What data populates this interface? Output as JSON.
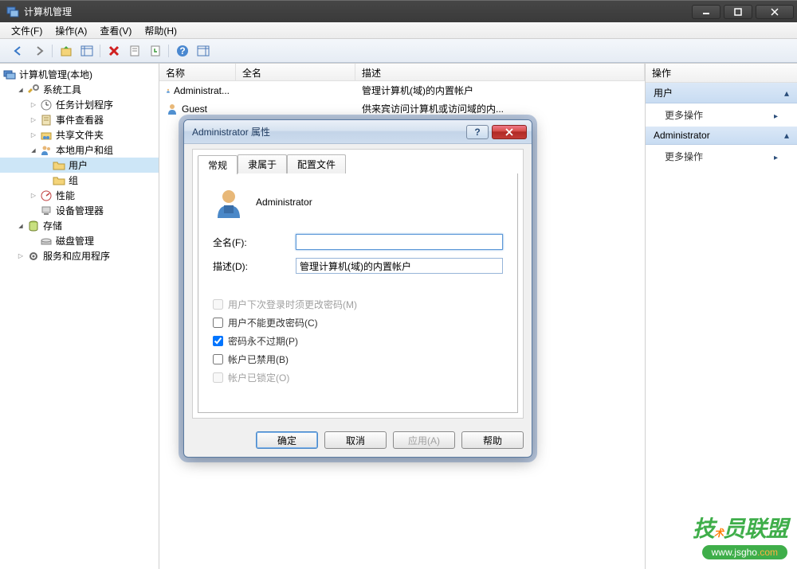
{
  "window": {
    "title": "计算机管理"
  },
  "menu": {
    "file": "文件(F)",
    "action": "操作(A)",
    "view": "查看(V)",
    "help": "帮助(H)"
  },
  "tree": {
    "root": "计算机管理(本地)",
    "system_tools": "系统工具",
    "task_scheduler": "任务计划程序",
    "event_viewer": "事件查看器",
    "shared_folders": "共享文件夹",
    "local_users_groups": "本地用户和组",
    "users": "用户",
    "groups": "组",
    "performance": "性能",
    "device_manager": "设备管理器",
    "storage": "存储",
    "disk_management": "磁盘管理",
    "services_apps": "服务和应用程序"
  },
  "list": {
    "columns": {
      "name": "名称",
      "fullname": "全名",
      "desc": "描述"
    },
    "rows": [
      {
        "name": "Administrat...",
        "fullname": "",
        "desc": "管理计算机(域)的内置帐户"
      },
      {
        "name": "Guest",
        "fullname": "",
        "desc": "供来宾访问计算机或访问域的内..."
      }
    ]
  },
  "actions": {
    "title": "操作",
    "section1": "用户",
    "more1": "更多操作",
    "section2": "Administrator",
    "more2": "更多操作"
  },
  "dialog": {
    "title": "Administrator 属性",
    "tabs": {
      "general": "常规",
      "memberof": "隶属于",
      "profile": "配置文件"
    },
    "username": "Administrator",
    "fullname_label": "全名(F):",
    "fullname_value": "",
    "desc_label": "描述(D):",
    "desc_value": "管理计算机(域)的内置帐户",
    "chk1": "用户下次登录时须更改密码(M)",
    "chk2": "用户不能更改密码(C)",
    "chk3": "密码永不过期(P)",
    "chk4": "帐户已禁用(B)",
    "chk5": "帐户已锁定(O)",
    "ok": "确定",
    "cancel": "取消",
    "apply": "应用(A)",
    "help": "帮助"
  },
  "watermark": {
    "text": "技术员联盟",
    "url": "www.jsgho.com"
  }
}
